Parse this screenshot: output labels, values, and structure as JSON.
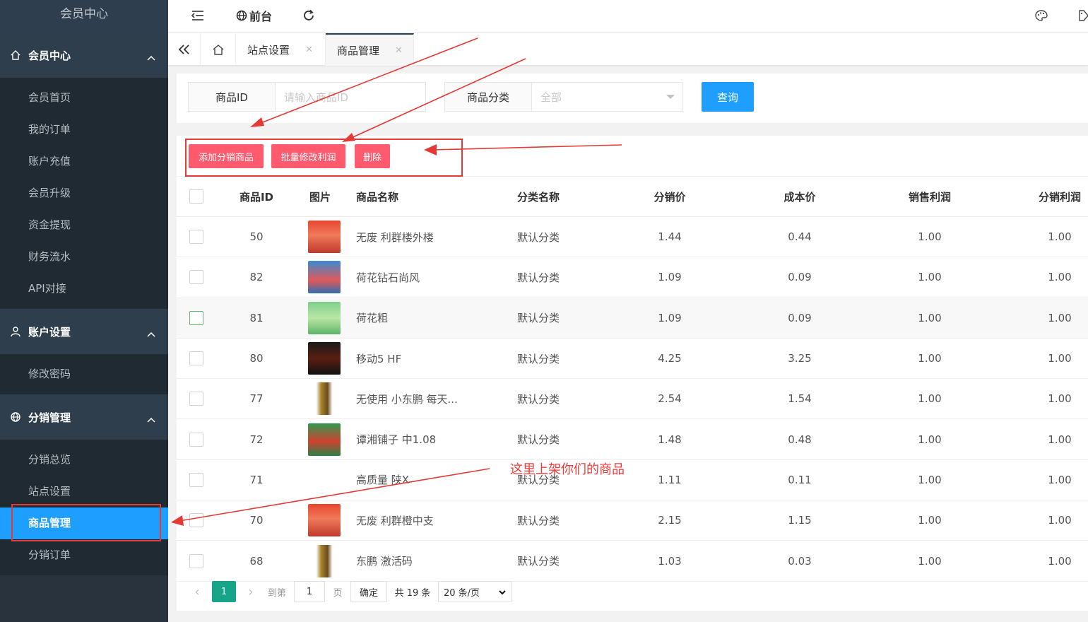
{
  "sidebar": {
    "title": "会员中心",
    "groups": [
      {
        "label": "会员中心",
        "icon": "home-icon",
        "items": [
          "会员首页",
          "我的订单",
          "账户充值",
          "会员升级",
          "资金提现",
          "财务流水",
          "API对接"
        ]
      },
      {
        "label": "账户设置",
        "icon": "user-icon",
        "items": [
          "修改密码"
        ]
      },
      {
        "label": "分销管理",
        "icon": "globe-icon",
        "items": [
          "分销总览",
          "站点设置",
          "商品管理",
          "分销订单"
        ]
      }
    ],
    "active_item": "商品管理"
  },
  "topbar": {
    "frontend_label": "前台"
  },
  "tabs": [
    {
      "label": "站点设置"
    },
    {
      "label": "商品管理"
    }
  ],
  "search": {
    "id_label": "商品ID",
    "id_placeholder": "请输入商品ID",
    "category_label": "商品分类",
    "category_value": "全部",
    "query_button": "查询"
  },
  "toolbar": {
    "add_button": "添加分销商品",
    "batch_button": "批量修改利润",
    "delete_button": "删除"
  },
  "table": {
    "headers": [
      "商品ID",
      "图片",
      "商品名称",
      "分类名称",
      "分销价",
      "成本价",
      "销售利润",
      "分销利润"
    ],
    "rows": [
      {
        "id": "50",
        "name": "无废 利群楼外楼",
        "category": "默认分类",
        "price": "1.44",
        "cost": "0.44",
        "sale_profit": "1.00",
        "dist_profit": "1.00"
      },
      {
        "id": "82",
        "name": "荷花钻石尚风",
        "category": "默认分类",
        "price": "1.09",
        "cost": "0.09",
        "sale_profit": "1.00",
        "dist_profit": "1.00"
      },
      {
        "id": "81",
        "name": "荷花粗",
        "category": "默认分类",
        "price": "1.09",
        "cost": "0.09",
        "sale_profit": "1.00",
        "dist_profit": "1.00"
      },
      {
        "id": "80",
        "name": "移动5 HF",
        "category": "默认分类",
        "price": "4.25",
        "cost": "3.25",
        "sale_profit": "1.00",
        "dist_profit": "1.00"
      },
      {
        "id": "77",
        "name": "无使用 小东鹏 每天...",
        "category": "默认分类",
        "price": "2.54",
        "cost": "1.54",
        "sale_profit": "1.00",
        "dist_profit": "1.00"
      },
      {
        "id": "72",
        "name": "谭湘铺子 中1.08",
        "category": "默认分类",
        "price": "1.48",
        "cost": "0.48",
        "sale_profit": "1.00",
        "dist_profit": "1.00"
      },
      {
        "id": "71",
        "name": "高质量 陕X",
        "category": "默认分类",
        "price": "1.11",
        "cost": "0.11",
        "sale_profit": "1.00",
        "dist_profit": "1.00"
      },
      {
        "id": "70",
        "name": "无废 利群橙中支",
        "category": "默认分类",
        "price": "2.15",
        "cost": "1.15",
        "sale_profit": "1.00",
        "dist_profit": "1.00"
      },
      {
        "id": "68",
        "name": "东鹏 激活码",
        "category": "默认分类",
        "price": "1.03",
        "cost": "0.03",
        "sale_profit": "1.00",
        "dist_profit": "1.00"
      }
    ]
  },
  "pagination": {
    "current_page": "1",
    "goto_label": "到第",
    "goto_value": "1",
    "page_unit": "页",
    "confirm_button": "确定",
    "total": "共 19 条",
    "page_size": "20 条/页"
  },
  "annotation": {
    "text": "这里上架你们的商品"
  },
  "colors": {
    "primary": "#1e9fff",
    "danger": "#ff5a6e",
    "sidebar": "#28333e",
    "annotation": "#e53935"
  }
}
